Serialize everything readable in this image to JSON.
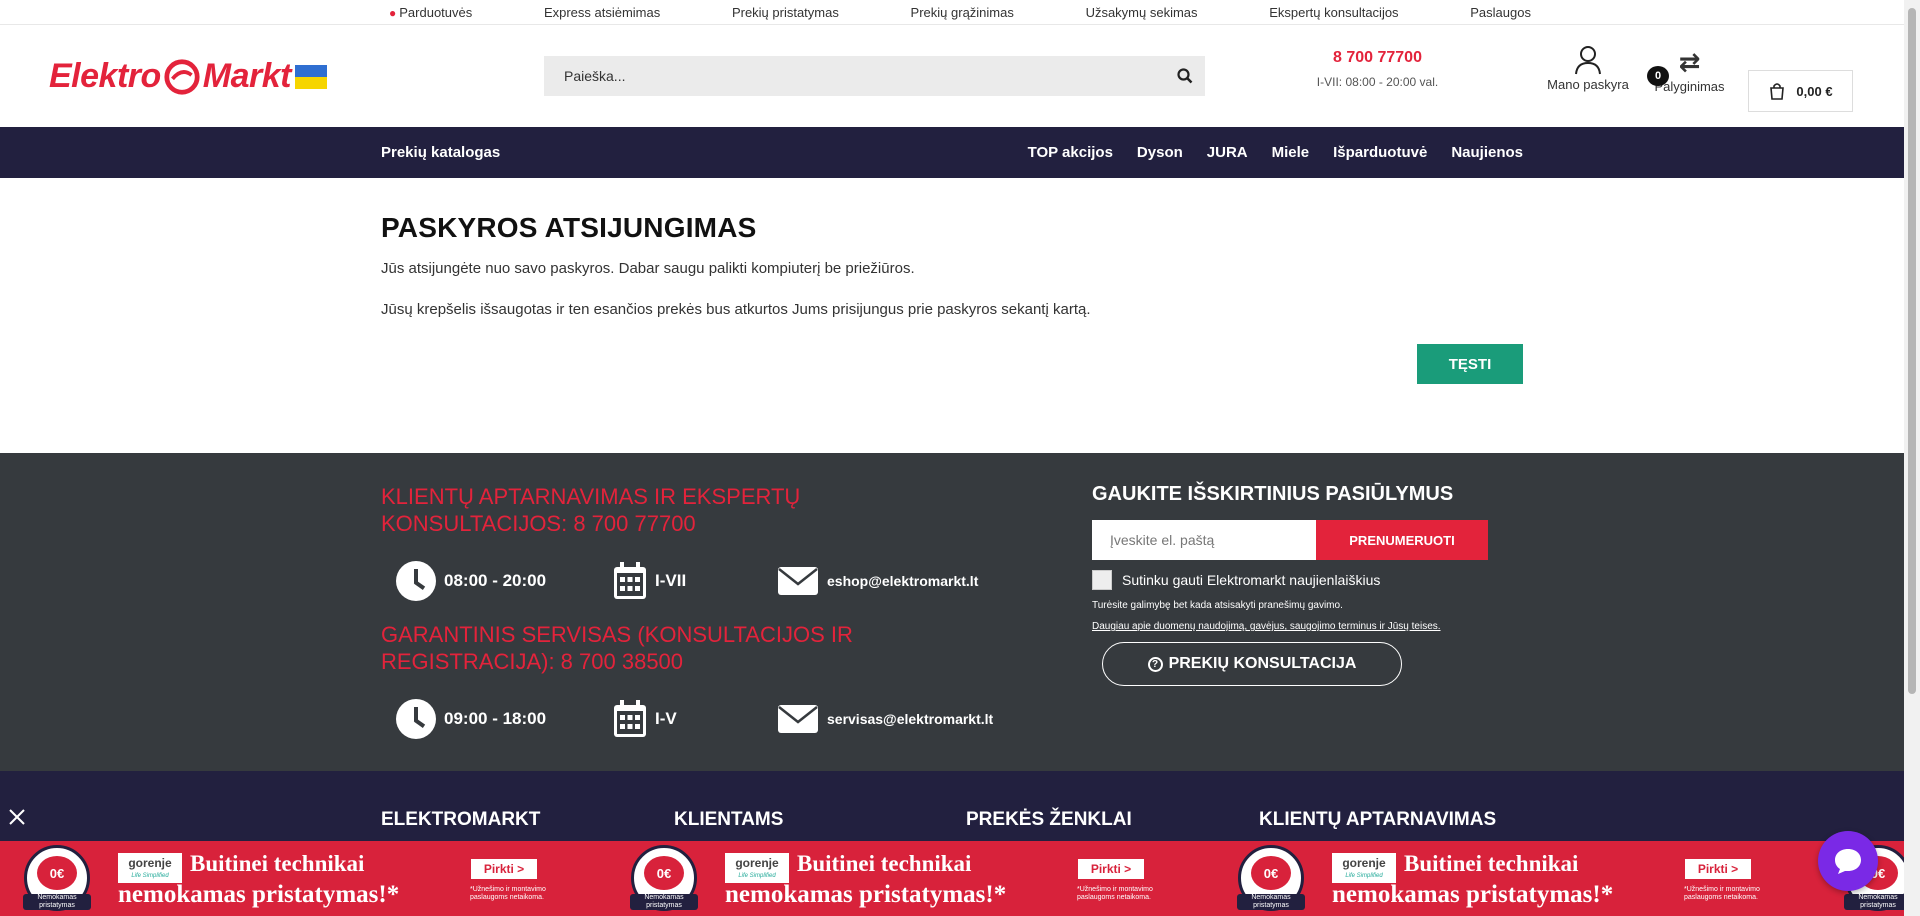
{
  "topbar": {
    "links": [
      "Parduotuvės",
      "Express atsiėmimas",
      "Prekių pristatymas",
      "Prekių grąžinimas",
      "Užsakymų sekimas",
      "Ekspertų konsultacijos",
      "Paslaugos"
    ]
  },
  "header": {
    "logo_left": "Elektro",
    "logo_right": "Markt",
    "search_placeholder": "Paieška...",
    "phone": "8 700 77700",
    "phone_hours": "I-VII: 08:00 - 20:00 val.",
    "account_label": "Mano paskyra",
    "compare_label": "Palyginimas",
    "compare_count": "0",
    "cart_total": "0,00 €"
  },
  "nav": {
    "catalog": "Prekių katalogas",
    "items": [
      "TOP akcijos",
      "Dyson",
      "JURA",
      "Miele",
      "Išparduotuvė",
      "Naujienos"
    ]
  },
  "content": {
    "title": "PASKYROS ATSIJUNGIMAS",
    "para1": "Jūs atsijungėte nuo savo paskyros. Dabar saugu palikti kompiuterį be priežiūros.",
    "para2": "Jūsų krepšelis išsaugotas ir ten esančios prekės bus atkurtos Jums prisijungus prie paskyros sekantį kartą.",
    "continue_label": "TĘSTI"
  },
  "footer_contact": {
    "section1_title": "KLIENTŲ APTARNAVIMAS IR EKSPERTŲ KONSULTACIJOS: 8 700 77700",
    "section1_hours": "08:00 - 20:00",
    "section1_days": "I-VII",
    "section1_email": "eshop@elektromarkt.lt",
    "section2_title": "GARANTINIS SERVISAS (KONSULTACIJOS IR REGISTRACIJA): 8 700 38500",
    "section2_hours": "09:00 - 18:00",
    "section2_days": "I-V",
    "section2_email": "servisas@elektromarkt.lt"
  },
  "newsletter": {
    "title": "GAUKITE IŠSKIRTINIUS PASIŪLYMUS",
    "email_placeholder": "Įveskite el. paštą",
    "subscribe_label": "PRENUMERUOTI",
    "checkbox_label": "Sutinku gauti Elektromarkt naujienlaiškius",
    "note": "Turėsite galimybę bet kada atsisakyti pranešimų gavimo.",
    "link": "Daugiau apie duomenų naudojimą, gavėjus, saugojimo terminus ir Jūsų teises.",
    "consult_label": "PREKIŲ KONSULTACIJA"
  },
  "footer_nav": {
    "columns": [
      "ELEKTROMARKT",
      "KLIENTAMS",
      "PREKĖS ŽENKLAI",
      "KLIENTŲ APTARNAVIMAS"
    ]
  },
  "promo": {
    "badge_price": "0€",
    "badge_text": "Nemokamas pristatymas",
    "brand": "gorenje",
    "brand_tagline": "Life Simplified",
    "line1": "Buitinei technikai",
    "line2": "nemokamas pristatymas!*",
    "cta": "Pirkti >",
    "footnote": "*Užnešimo ir montavimo paslaugoms netaikoma."
  },
  "colors": {
    "brand_red": "#e3233b",
    "nav_dark": "#22203f",
    "footer_dark": "#363a3e",
    "continue_green": "#1a9c7a",
    "chat_purple": "#7a29e6"
  }
}
